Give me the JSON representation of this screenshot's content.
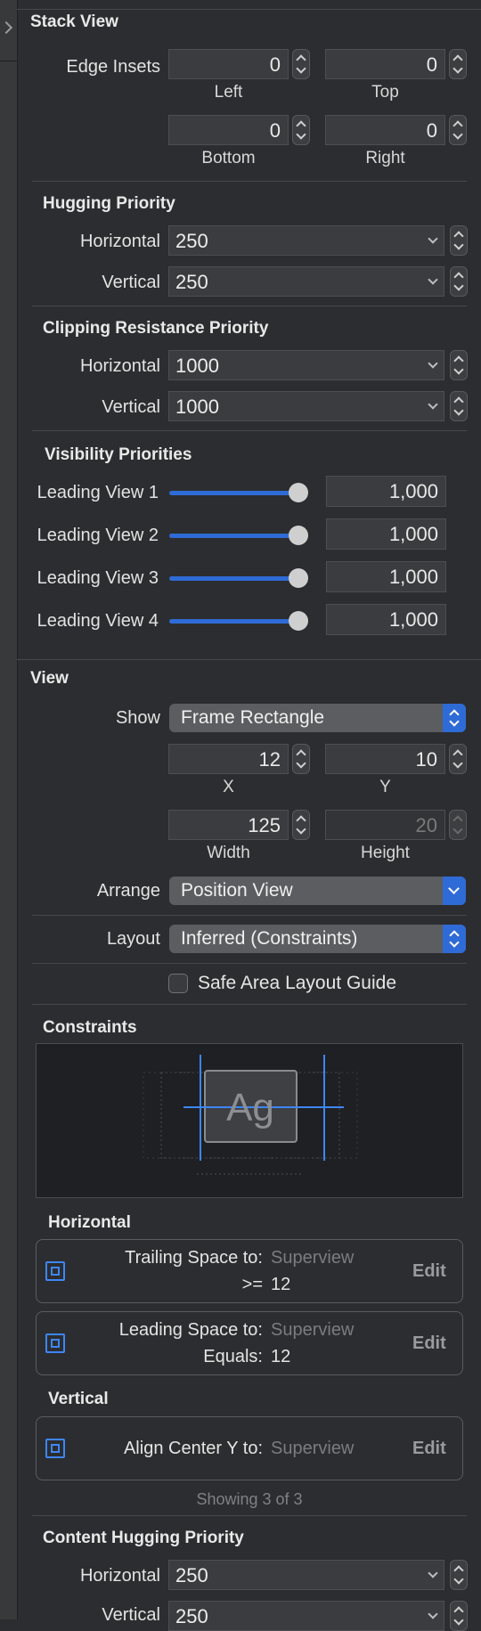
{
  "stack_view": {
    "title": "Stack View",
    "edge_insets_label": "Edge Insets",
    "left": {
      "value": "0",
      "label": "Left"
    },
    "top": {
      "value": "0",
      "label": "Top"
    },
    "bottom": {
      "value": "0",
      "label": "Bottom"
    },
    "right": {
      "value": "0",
      "label": "Right"
    }
  },
  "hugging": {
    "title": "Hugging Priority",
    "horizontal_label": "Horizontal",
    "horizontal_value": "250",
    "vertical_label": "Vertical",
    "vertical_value": "250"
  },
  "clipping": {
    "title": "Clipping Resistance Priority",
    "horizontal_label": "Horizontal",
    "horizontal_value": "1000",
    "vertical_label": "Vertical",
    "vertical_value": "1000"
  },
  "visibility": {
    "title": "Visibility Priorities",
    "items": [
      {
        "label": "Leading View 1",
        "value": "1,000",
        "level": 1.0
      },
      {
        "label": "Leading View 2",
        "value": "1,000",
        "level": 1.0
      },
      {
        "label": "Leading View 3",
        "value": "1,000",
        "level": 1.0
      },
      {
        "label": "Leading View 4",
        "value": "1,000",
        "level": 1.0
      }
    ]
  },
  "view": {
    "title": "View",
    "show_label": "Show",
    "show_value": "Frame Rectangle",
    "x": {
      "value": "12",
      "label": "X"
    },
    "y": {
      "value": "10",
      "label": "Y"
    },
    "width": {
      "value": "125",
      "label": "Width"
    },
    "height": {
      "value": "20",
      "label": "Height"
    },
    "arrange_label": "Arrange",
    "arrange_value": "Position View",
    "layout_label": "Layout",
    "layout_value": "Inferred (Constraints)",
    "safe_area_label": "Safe Area Layout Guide"
  },
  "constraints": {
    "title": "Constraints",
    "preview_text": "Ag",
    "horizontal_title": "Horizontal",
    "vertical_title": "Vertical",
    "items": [
      {
        "line1": "Trailing Space to:",
        "target": "Superview",
        "relation": ">=",
        "constant": "12",
        "edit": "Edit"
      },
      {
        "line1": "Leading Space to:",
        "target": "Superview",
        "relation": "Equals:",
        "constant": "12",
        "edit": "Edit"
      },
      {
        "line1": "Align Center Y to:",
        "target": "Superview",
        "edit": "Edit"
      }
    ],
    "showing": "Showing 3 of 3"
  },
  "content_hugging": {
    "title": "Content Hugging Priority",
    "horizontal_label": "Horizontal",
    "horizontal_value": "250",
    "vertical_label": "Vertical",
    "vertical_value": "250"
  },
  "colors": {
    "accent": "#2f6bd6",
    "background": "#2c2d30",
    "constraint_blue": "#3d86f6"
  }
}
